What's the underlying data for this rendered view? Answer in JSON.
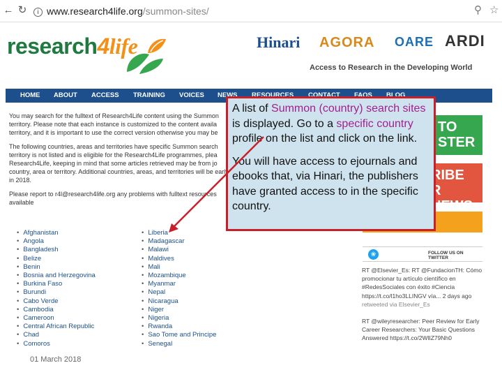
{
  "browser": {
    "back_icon": "back-arrow-icon",
    "forward_icon": "forward-arrow-icon",
    "refresh_icon": "refresh-icon",
    "url_host": "www.research4life.org",
    "url_path": "/summon-sites/"
  },
  "logo": {
    "part1": "research",
    "part2": "4",
    "part3": "life"
  },
  "partners": [
    "Hinari",
    "AGORA",
    "OARE",
    "ARDI"
  ],
  "tagline": "Access to Research in the Developing World",
  "nav": [
    "HOME",
    "ABOUT",
    "ACCESS",
    "TRAINING",
    "VOICES",
    "NEWS",
    "RESOURCES",
    "CONTACT",
    "FAQS",
    "BLOG"
  ],
  "content": {
    "p1": "You may search for the fulltext of Research4Life content using the Summon territory. Please note that each instance is customized to the content availa territory, and it is important to use the correct version otherwise you may be",
    "p2": "The following countries, areas and territories have specific Summon search territory is not listed and is eligible for the Research4Life programmes, plea Research4Life, keeping in mind that some articles retrieved may be from jo country, area or territory. Additional countries, areas, and territories will be early in 2018.",
    "p3": "Please report to r4l@research4life.org any problems with fulltext resources available"
  },
  "countries_col1": [
    "Afghanistan",
    "Angola",
    "Bangladesh",
    "Belize",
    "Benin",
    "Bosnia and Herzegovina",
    "Burkina Faso",
    "Burundi",
    "Cabo Verde",
    "Cambodia",
    "Cameroon",
    "Central African Republic",
    "Chad",
    "Comoros"
  ],
  "countries_col2": [
    "Liberia",
    "Madagascar",
    "Malawi",
    "Maldives",
    "Mali",
    "Mozambique",
    "Myanmar",
    "Nepal",
    "Nicaragua",
    "Niger",
    "Nigeria",
    "Rwanda",
    "Sao Tome and Principe",
    "Senegal"
  ],
  "sidebar": {
    "green_text": "TO\nSTER",
    "red_text": "RIBE\nR NEWS",
    "twitter_label": "FOLLOW US ON TWITTER",
    "tweets": [
      {
        "text": "RT @Elsevier_Es: RT @FundacionTH: Cómo promocionar tu artículo científico en #RedesSociales con éxito #Ciencia https://t.co/l1ho3LLINGV vía... 2 days ago",
        "via": "retweeted via Elsevier_Es"
      },
      {
        "text": "RT @wileyresearcher: Peer Review for Early Career Researchers: Your Basic Questions Answered https://t.co/2WlIZ79Nh0",
        "via": ""
      }
    ]
  },
  "date": "01 March 2018",
  "callout": {
    "p1_a": "A list of ",
    "p1_hl": "Summon (country) search sites",
    "p1_b": " is displayed.  Go to a ",
    "p1_hl2": "specific country",
    "p1_c": " profile on the list and click on the link.",
    "p2": "You will have access to ejournals and ebooks that, via Hinari, the publishers have granted access to in the specific country."
  },
  "colors": {
    "nav_bg": "#1c4f8c",
    "callout_border": "#c8202a",
    "callout_bg": "#cfe3ee",
    "highlight": "#a0208f"
  }
}
